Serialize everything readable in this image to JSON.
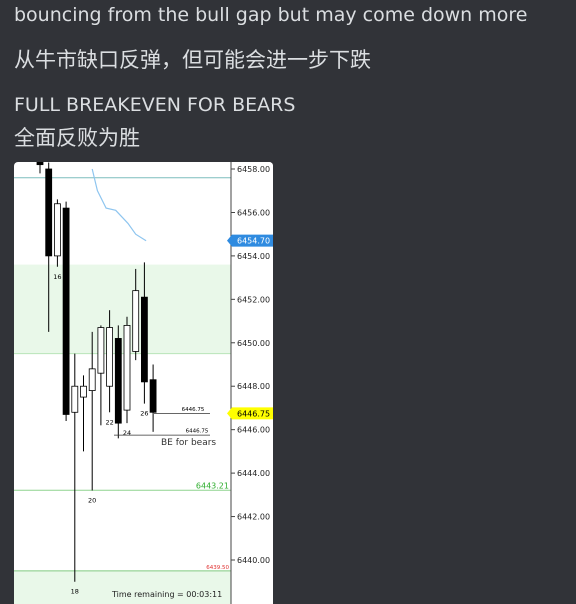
{
  "message": {
    "line1": "bouncing from the bull gap but may come down more",
    "line2": "从牛市缺口反弹，但可能会进一步下跌",
    "line3": "FULL BREAKEVEN FOR BEARS",
    "line4": "全面反败为胜"
  },
  "chart_data": {
    "type": "candlestick",
    "ylim": [
      6438.8,
      6458.5
    ],
    "y_ticks": [
      "6458.00",
      "6456.00",
      "6454.00",
      "6452.00",
      "6450.00",
      "6448.00",
      "6446.00",
      "6444.00",
      "6442.00",
      "6440.00"
    ],
    "price_tags": [
      {
        "label": "6454.70",
        "value": 6454.7,
        "color": "#2f8be0",
        "text_color": "#ffffff"
      },
      {
        "label": "6446.75",
        "value": 6446.75,
        "color": "#ffff00",
        "text_color": "#000000"
      }
    ],
    "levels": [
      {
        "label": "6443.21",
        "value": 6443.21,
        "color": "#2fae2f"
      },
      {
        "label": "6439.50",
        "value": 6439.5,
        "color": "#e03030"
      }
    ],
    "small_levels": [
      {
        "label": "6446.75",
        "value": 6446.75
      },
      {
        "label": "6446.75",
        "value": 6445.75
      }
    ],
    "candle_labels": [
      {
        "label": "16",
        "x": 3
      },
      {
        "label": "18",
        "x": 5
      },
      {
        "label": "20",
        "x": 7
      },
      {
        "label": "22",
        "x": 9
      },
      {
        "label": "24",
        "x": 11
      },
      {
        "label": "26",
        "x": 13
      }
    ],
    "annotation": "BE for bears",
    "footer": "Time remaining = 00:03:11",
    "candles": [
      {
        "x": 1,
        "open": 6460.0,
        "close": 6458.2,
        "high": 6460.0,
        "low": 6457.8
      },
      {
        "x": 2,
        "open": 6458.0,
        "close": 6454.0,
        "high": 6458.3,
        "low": 6450.5
      },
      {
        "x": 3,
        "open": 6454.0,
        "close": 6456.4,
        "high": 6456.6,
        "low": 6453.5
      },
      {
        "x": 4,
        "open": 6456.2,
        "close": 6446.7,
        "high": 6456.5,
        "low": 6446.4
      },
      {
        "x": 5,
        "open": 6446.8,
        "close": 6448.0,
        "high": 6449.5,
        "low": 6439.0
      },
      {
        "x": 6,
        "open": 6447.5,
        "close": 6448.0,
        "high": 6448.5,
        "low": 6445.0
      },
      {
        "x": 7,
        "open": 6447.8,
        "close": 6448.8,
        "high": 6450.5,
        "low": 6443.2
      },
      {
        "x": 8,
        "open": 6448.6,
        "close": 6450.7,
        "high": 6450.8,
        "low": 6446.2
      },
      {
        "x": 9,
        "open": 6448.0,
        "close": 6450.7,
        "high": 6451.5,
        "low": 6446.8
      },
      {
        "x": 10,
        "open": 6450.2,
        "close": 6446.3,
        "high": 6450.8,
        "low": 6445.6
      },
      {
        "x": 11,
        "open": 6446.9,
        "close": 6450.8,
        "high": 6451.2,
        "low": 6446.3
      },
      {
        "x": 12,
        "open": 6449.6,
        "close": 6452.4,
        "high": 6453.4,
        "low": 6449.2
      },
      {
        "x": 13,
        "open": 6452.1,
        "close": 6448.2,
        "high": 6453.7,
        "low": 6447.2
      },
      {
        "x": 14,
        "open": 6448.3,
        "close": 6446.8,
        "high": 6449.0,
        "low": 6445.9
      }
    ],
    "ma_line": [
      {
        "x": 7.0,
        "y": 6458.0
      },
      {
        "x": 7.6,
        "y": 6457.0
      },
      {
        "x": 8.6,
        "y": 6456.2
      },
      {
        "x": 9.7,
        "y": 6456.1
      },
      {
        "x": 11.1,
        "y": 6455.5
      },
      {
        "x": 12.0,
        "y": 6455.0
      },
      {
        "x": 13.2,
        "y": 6454.7
      }
    ],
    "zones": [
      {
        "from": 6449.5,
        "to": 6453.6,
        "color": "#e9f8e9"
      },
      {
        "from": 6438.8,
        "to": 6439.5,
        "color": "#e9f8e9"
      }
    ],
    "ref_lines": [
      {
        "value": 6457.6,
        "color": "#7dbdbd"
      },
      {
        "value": 6449.5,
        "color": "#b9e5b9"
      },
      {
        "value": 6443.21,
        "color": "#8fd38f"
      },
      {
        "value": 6439.5,
        "color": "#7fc97f"
      }
    ]
  }
}
